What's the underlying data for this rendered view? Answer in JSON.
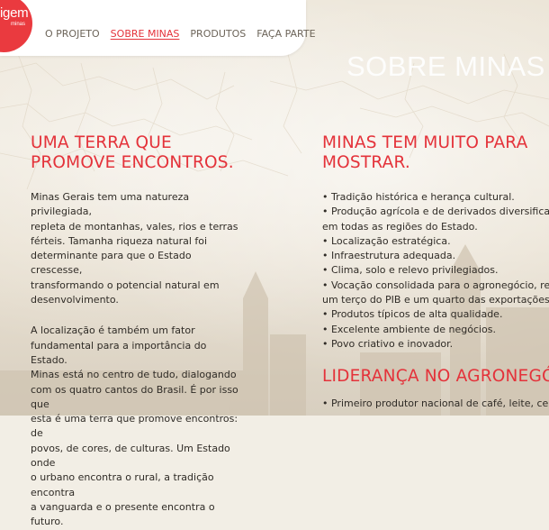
{
  "logo": {
    "word": "igem",
    "sub": "minas"
  },
  "nav": [
    {
      "label": "O PROJETO",
      "active": false
    },
    {
      "label": "SOBRE MINAS",
      "active": true
    },
    {
      "label": "PRODUTOS",
      "active": false
    },
    {
      "label": "FAÇA PARTE",
      "active": false
    }
  ],
  "section_title": "SOBRE MINAS",
  "left": {
    "title_line1": "UMA TERRA QUE",
    "title_line2": "PROMOVE ENCONTROS.",
    "p1": "Minas Gerais tem uma natureza privilegiada,\nrepleta de montanhas, vales, rios e terras\nférteis. Tamanha riqueza natural foi\ndeterminante para que o Estado crescesse,\ntransformando o potencial natural em\ndesenvolvimento.",
    "p2": "A localização é também um fator\nfundamental para a importância do Estado.\nMinas está no centro de tudo, dialogando\ncom os quatro cantos do Brasil. É por isso que\nesta é uma terra que promove encontros: de\npovos, de cores, de culturas. Um Estado onde\no urbano encontra o rural, a tradição encontra\na vanguarda e o presente encontra o futuro."
  },
  "right": {
    "title_line1": "MINAS TEM MUITO PARA",
    "title_line2": "MOSTRAR.",
    "bullets": [
      "• Tradição histórica e herança cultural.",
      "• Produção agrícola e de derivados diversificada",
      "em todas as regiões do Estado.",
      "• Localização estratégica.",
      "• Infraestrutura adequada.",
      "• Clima, solo e relevo privilegiados.",
      "• Vocação consolidada para o agronegócio, repr",
      "um terço do PIB e um quarto das exportações d",
      "• Produtos típicos de alta qualidade.",
      "• Excelente ambiente de negócios.",
      "• Povo criativo e inovador."
    ],
    "title2": "LIDERANÇA NO AGRONEGÓ",
    "last_line": "• Primeiro produtor nacional de café, leite, ceno"
  }
}
